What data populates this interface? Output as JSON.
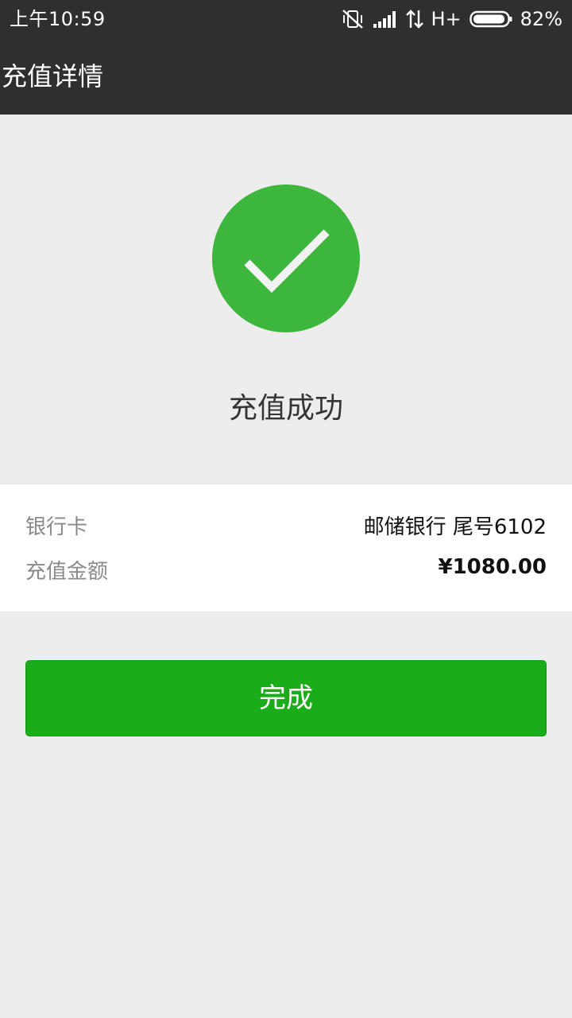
{
  "status_bar": {
    "time": "上午10:59",
    "network": "H+",
    "battery": "82%",
    "icons": [
      "vibrate-off-icon",
      "signal-icon",
      "data-arrows-icon",
      "battery-icon"
    ]
  },
  "header": {
    "title": "充值详情"
  },
  "result": {
    "icon": "checkmark-icon",
    "text": "充值成功"
  },
  "details": {
    "bank_label": "银行卡",
    "bank_value": "邮储银行 尾号6102",
    "amount_label": "充值金额",
    "amount_value": "¥1080.00"
  },
  "actions": {
    "done_label": "完成"
  },
  "colors": {
    "bar": "#2f2f2f",
    "success": "#3db63d",
    "button": "#1aad19",
    "background": "#ededed"
  }
}
